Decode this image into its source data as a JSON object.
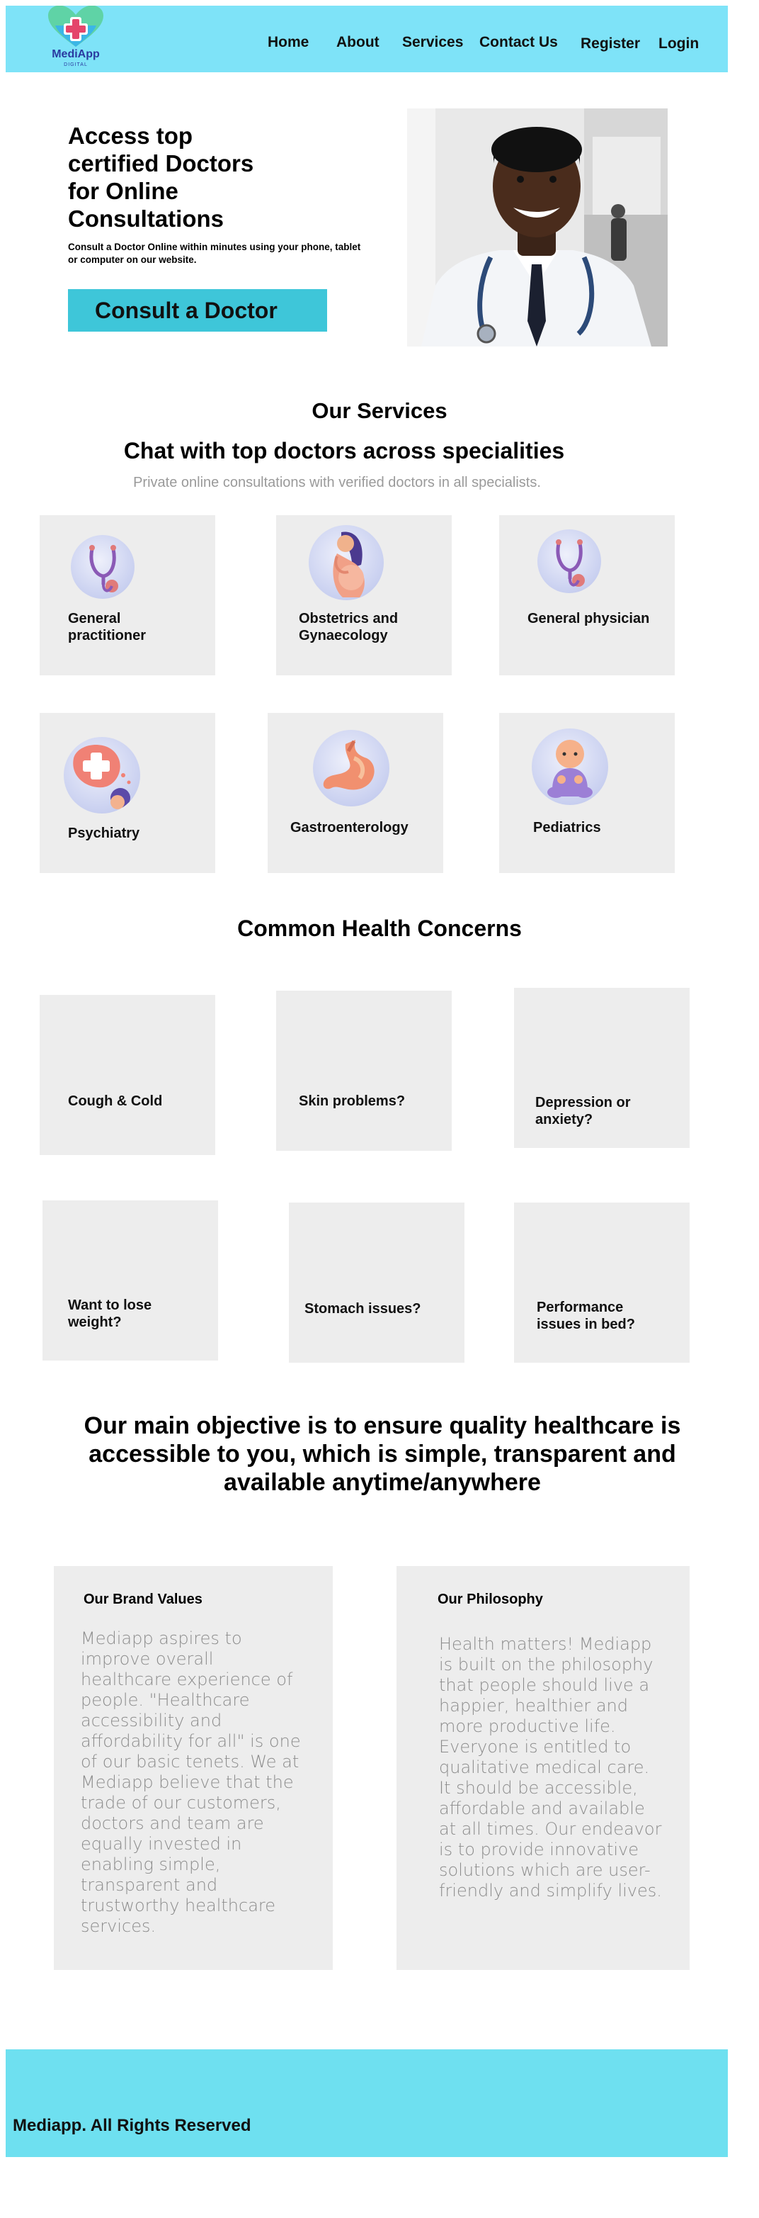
{
  "header": {
    "logo_text": "MediApp",
    "logo_sub": "DIGITAL",
    "nav": [
      "Home",
      "About",
      "Services",
      "Contact Us",
      "Register",
      "Login"
    ]
  },
  "hero": {
    "title": "Access top certified Doctors for Online Consultations",
    "subtitle": "Consult a Doctor Online within minutes using your phone, tablet or computer on our website.",
    "cta": "Consult a Doctor"
  },
  "services": {
    "title": "Our Services",
    "heading": "Chat with top doctors across specialities",
    "subheading": "Private online consultations with verified doctors in all specialists.",
    "items": [
      {
        "label": "General practitioner",
        "icon": "stethoscope-icon"
      },
      {
        "label": "Obstetrics and Gynaecology",
        "icon": "pregnant-woman-icon"
      },
      {
        "label": "General physician",
        "icon": "stethoscope-icon"
      },
      {
        "label": "Psychiatry",
        "icon": "mental-health-icon"
      },
      {
        "label": "Gastroenterology",
        "icon": "stomach-icon"
      },
      {
        "label": "Pediatrics",
        "icon": "baby-icon"
      }
    ]
  },
  "concerns": {
    "title": "Common Health Concerns",
    "items": [
      "Cough & Cold",
      "Skin problems?",
      "Depression or anxiety?",
      "Want to lose weight?",
      "Stomach issues?",
      "Performance issues in bed?"
    ]
  },
  "objective": "Our main objective is to ensure quality healthcare is accessible to you, which is simple, transparent and available anytime/anywhere",
  "values": {
    "brand_title": "Our Brand Values",
    "brand_body": "Mediapp aspires to improve overall healthcare experience of people. \"Healthcare accessibility and affordability for all\" is one of our basic tenets. We at Mediapp believe that the trade of our customers, doctors and team are equally invested in enabling simple, transparent and trustworthy healthcare services.",
    "philosophy_title": "Our Philosophy",
    "philosophy_body": "Health matters! Mediapp is built on the philosophy that people should live a happier, healthier and more productive life. Everyone is entitled to qualitative medical care. It should be accessible, affordable and available at all times. Our endeavor is to provide innovative solutions which are user-friendly and simplify lives."
  },
  "footer": {
    "text": "Mediapp. All Rights Reserved"
  },
  "colors": {
    "header_bg": "#7ee3f8",
    "cta_bg": "#3ec6d9",
    "footer_bg": "#6ee0f0",
    "card_bg": "#ededed"
  }
}
